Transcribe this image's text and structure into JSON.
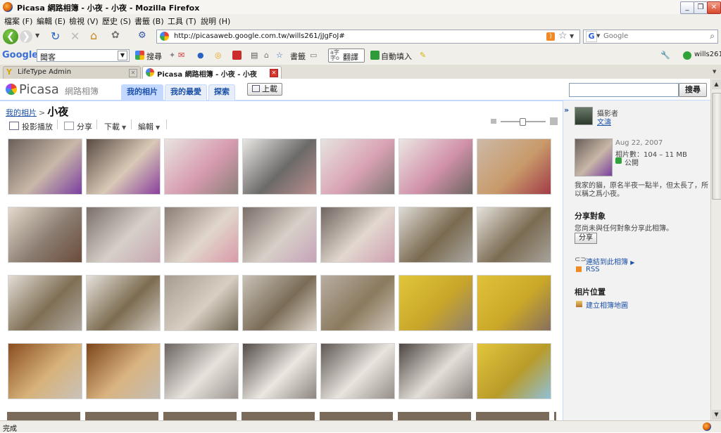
{
  "window": {
    "title": "Picasa 網路相簿 - 小夜 - 小夜 - Mozilla Firefox"
  },
  "menu": [
    "檔案 (F)",
    "編輯 (E)",
    "檢視 (V)",
    "歷史 (S)",
    "書籤 (B)",
    "工具 (T)",
    "說明 (H)"
  ],
  "nav": {
    "url": "http://picasaweb.google.com.tw/wills261/jJgFoJ#",
    "search_placeholder": "Google",
    "search_engine": "G"
  },
  "gtoolbar": {
    "logo": "Google",
    "query": "聞客",
    "search": "搜尋",
    "bookmarks": "書籤",
    "translate": "翻譯",
    "autofill": "自動填入",
    "user": "wills261"
  },
  "tabs": [
    {
      "label": "LifeType Admin",
      "active": false
    },
    {
      "label": "Picasa 網路相簿 - 小夜 - 小夜",
      "active": true
    }
  ],
  "picasa": {
    "logo": "Picasa",
    "subtitle": "網路相簿",
    "nav_tabs": [
      "我的相片",
      "我的最愛",
      "探索"
    ],
    "upload": "上載",
    "search_button": "搜尋"
  },
  "album": {
    "crumb_link": "我的相片",
    "crumb_sep": ">",
    "name": "小夜",
    "actions": {
      "slideshow": "投影播放",
      "share": "分享",
      "download": "下載",
      "edit": "編輯"
    }
  },
  "photos": [
    [
      "#6a5f5a",
      "#c9b8a8",
      "#7a3fa0"
    ],
    [
      "#5a4b44",
      "#d9c9b6",
      "#8a3f9e"
    ],
    [
      "#e8e4e0",
      "#d79bb0",
      "#8d8078"
    ],
    [
      "#e9e7e4",
      "#6b6a68",
      "#ba8e8e"
    ],
    [
      "#e6e3df",
      "#d9a2b4",
      "#7f7572"
    ],
    [
      "#ebe6e2",
      "#d191aa",
      "#6d6560"
    ],
    [
      "#ccb9a8",
      "#c89a6a",
      "#a23c48"
    ],
    [
      "#e4d9cc",
      "#8a7c70",
      "#6b4c3a"
    ],
    [
      "#7a6f6a",
      "#d6cfc8",
      "#c8a7b2"
    ],
    [
      "#8b7e76",
      "#e1d6cc",
      "#d99aa8"
    ],
    [
      "#7a6e68",
      "#d8d0c8",
      "#c5a2b8"
    ],
    [
      "#6f645e",
      "#e2d8cf",
      "#cfa0b0"
    ],
    [
      "#dfdcd6",
      "#7a6a50",
      "#a9a6a0"
    ],
    [
      "#e5e2dc",
      "#7b6b52",
      "#a7a39b"
    ],
    [
      "#e2ddd6",
      "#7f6f54",
      "#b0a9a0"
    ],
    [
      "#e5e1db",
      "#7c6c50",
      "#d2cbc2"
    ],
    [
      "#a79c90",
      "#d8cfc3",
      "#6f6552"
    ],
    [
      "#c9c2b8",
      "#7a6c56",
      "#e0d8ce"
    ],
    [
      "#b8ada2",
      "#8a7a5e",
      "#cfc4b8"
    ],
    [
      "#e0c63a",
      "#c9a62a",
      "#8f7f6e"
    ],
    [
      "#e0c23b",
      "#cba828",
      "#866f5e"
    ],
    [
      "#8a4d20",
      "#d7b27a",
      "#c9c2bb"
    ],
    [
      "#7d4519",
      "#d9b480",
      "#c4bdb5"
    ],
    [
      "#6b6460",
      "#e7e2dc",
      "#9c9591"
    ],
    [
      "#534c48",
      "#ece7e1",
      "#8c8580"
    ],
    [
      "#5e5753",
      "#e9e4de",
      "#948d88"
    ],
    [
      "#4d4642",
      "#e4ded8",
      "#8a837e"
    ],
    [
      "#e3c63c",
      "#b99b2a",
      "#8fc0d8"
    ]
  ],
  "sidebar": {
    "photographer_label": "攝影者",
    "photographer_name": "文濤",
    "date": "Aug 22, 2007",
    "stats": "相片數：104 – 11 MB",
    "visibility": "公開",
    "desc_line1": "我家的貓，原名半夜一點半，但太長了，所",
    "desc_line2": "以稱之爲小夜。",
    "share_heading": "分享對象",
    "share_note": "您尚未與任何對象分享此相簿。",
    "share_button": "分享",
    "link_album": "連結到此相簿",
    "rss": "RSS",
    "location_heading": "相片位置",
    "create_map": "建立相簿地圖"
  },
  "status": {
    "text": "完成"
  }
}
